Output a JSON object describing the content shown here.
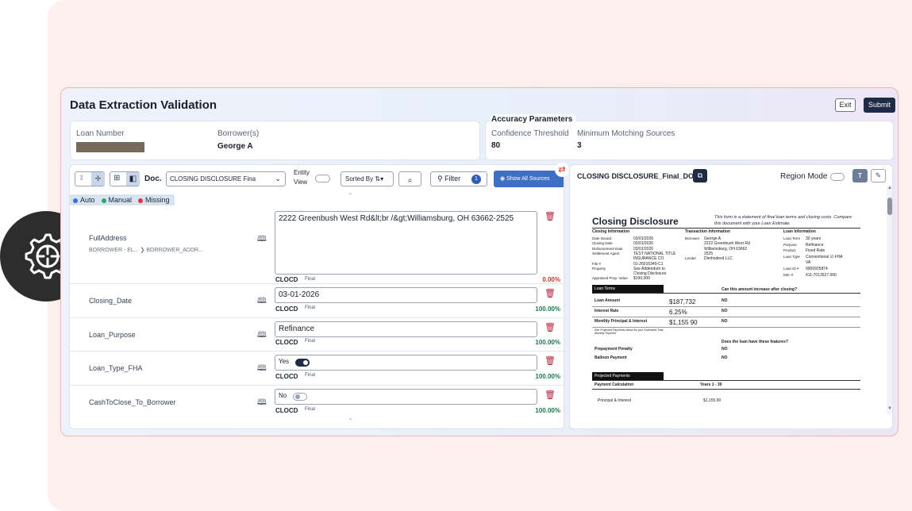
{
  "app": {
    "title": "Data Extraction Validation",
    "exit_label": "Exit",
    "submit_label": "Submit"
  },
  "loan": {
    "number_label": "Loan Number",
    "borrower_label": "Borrower(s)",
    "borrower_value": "George A"
  },
  "accuracy": {
    "title": "Accuracy Parameters",
    "confidence_label": "Confidence Threshold",
    "confidence_value": "80",
    "matching_label": "Minimum Motching Sources",
    "matching_value": "3"
  },
  "toolbar": {
    "doc_label": "Doc.",
    "doc_select": "CLOSING DISCLOSURE Fina",
    "entity_view_label": "Entity\nView",
    "sorted_by_label": "Sorted By",
    "filter_label": "Filter",
    "filter_count": "1",
    "show_all_sources_label": "Show All Sources"
  },
  "legend": [
    {
      "label": "Auto",
      "color": "#3b6fd8"
    },
    {
      "label": "Manual",
      "color": "#2fa56a"
    },
    {
      "label": "Missing",
      "color": "#e0344b"
    }
  ],
  "fields": [
    {
      "name": "FullAddress",
      "sub": "BORROWER - EL... ❯ BORROWER_ADDR...",
      "value": "2222 Greenbush West Rd&lt;br /&gt;Williamsburg, OH 63662-2525",
      "source": "CLOCD",
      "status": "Final",
      "pct": "0.00%",
      "pct_color": "#c0392b"
    },
    {
      "name": "Closing_Date",
      "value": "03-01-2026",
      "source": "CLOCD",
      "status": "Final",
      "pct": "100.00%",
      "pct_color": "#1e7a55"
    },
    {
      "name": "Loan_Purpose",
      "value": "Refinance",
      "source": "CLOCD",
      "status": "Final",
      "pct": "100.00%",
      "pct_color": "#1e7a55"
    },
    {
      "name": "Loan_Type_FHA",
      "value": "Yes",
      "toggle_on": true,
      "source": "CLOCD",
      "status": "Final",
      "pct": "100.00%",
      "pct_color": "#1e7a55"
    },
    {
      "name": "CashToClose_To_Borrower",
      "value": "No",
      "toggle_on": false,
      "source": "CLOCD",
      "status": "Final",
      "pct": "100.00%",
      "pct_color": "#1e7a55"
    }
  ],
  "viewer": {
    "file_name": "CLOSING DISCLOSURE_Final_DO...",
    "region_mode_label": "Region Mode",
    "text_mode_label": "T",
    "doc": {
      "title": "Closing Disclosure",
      "intro": "This form is a statement of final loan terms and closing costs. Compare this document with your Loan Estimate.",
      "closing_info_head": "Closing Information",
      "transaction_head": "Transaction Information",
      "loan_info_head": "Loan Information",
      "closing_rows": [
        [
          "Date Issued",
          "03/01/2026"
        ],
        [
          "Closing Date",
          "03/01/2026"
        ],
        [
          "Disbursement Date",
          "03/01/2026"
        ],
        [
          "Settlement Agent",
          "TEST NATIONAL TITLE"
        ],
        [
          "",
          "INSURANCE CO"
        ],
        [
          "File #",
          "01-26016349-C1"
        ],
        [
          "Property",
          "See Addendum to"
        ],
        [
          "",
          "Closing Disclosure"
        ],
        [
          "Appraised Prop. Value",
          "$190,000"
        ]
      ],
      "transaction_rows": [
        [
          "Borrower",
          "George A"
        ],
        [
          "",
          "2222 Greenbush West Rd"
        ],
        [
          "",
          "Williamsburg, OH 63662"
        ],
        [
          "",
          "2525"
        ],
        [
          "Lender",
          "Dimhodevd LLC"
        ]
      ],
      "loan_rows": [
        [
          "Loan Term",
          "30 years"
        ],
        [
          "Purpose",
          "Refinance"
        ],
        [
          "Product",
          "Fixed Rate"
        ],
        [
          "Loan Type",
          "Conventional ☑ FHA"
        ],
        [
          "",
          "VA"
        ],
        [
          "Loan ID #",
          "9900925874"
        ],
        [
          "MIC #",
          "411-7013527.000"
        ]
      ],
      "loan_terms_head": "Loan Terms",
      "increase_q": "Can this amount increase after closing?",
      "terms": [
        {
          "label": "Loan Amount",
          "value": "$187,732",
          "answer": "NO"
        },
        {
          "label": "Interest Rate",
          "value": "6.25%",
          "answer": "NO"
        },
        {
          "label": "Monthly Principal & Interest",
          "value": "$1,155 90",
          "answer": "NO"
        }
      ],
      "terms_note": "See Projected Payments below for your Estimated Total Monthly Payment",
      "features_q": "Does the loan have these features?",
      "features": [
        {
          "label": "Prepayment Penalty",
          "answer": "NO"
        },
        {
          "label": "Balloon Payment",
          "answer": "NO"
        }
      ],
      "projected_head": "Projected Payments",
      "payment_calc": "Payment Calculation",
      "years": "Years 1 - 30",
      "pi_label": "Principal & Interest",
      "pi_value": "$1,155.90"
    }
  }
}
